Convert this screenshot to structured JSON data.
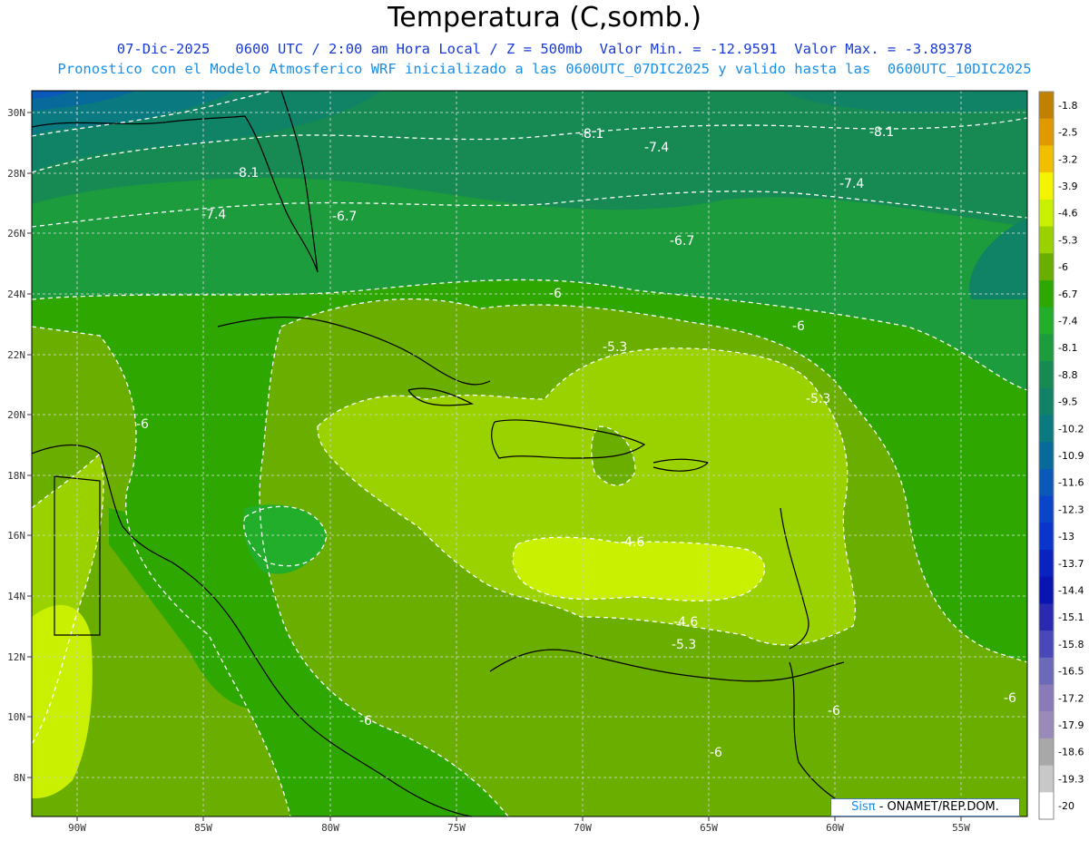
{
  "header": {
    "title": "Temperatura (C,somb.)",
    "line1": "07-Dic-2025   0600 UTC / 2:00 am Hora Local / Z = 500mb  Valor Min. = -12.9591  Valor Max. = -3.89378",
    "line2": "Pronostico con el Modelo Atmosferico WRF inicializado a las 0600UTC_07DIC2025 y valido hasta las  0600UTC_10DIC2025"
  },
  "map": {
    "lat_labels": [
      "30N",
      "28N",
      "26N",
      "24N",
      "22N",
      "20N",
      "18N",
      "16N",
      "14N",
      "12N",
      "10N",
      "8N"
    ],
    "lon_labels": [
      "90W",
      "85W",
      "80W",
      "75W",
      "70W",
      "65W",
      "60W",
      "55W"
    ],
    "contour_labels": [
      "-8.1",
      "-7.4",
      "-8.1",
      "-8.1",
      "-7.4",
      "-7.4",
      "-6.7",
      "-6.7",
      "-6",
      "-6",
      "-5.3",
      "-5.3",
      "-6",
      "-4.6",
      "-4.6",
      "-5.3",
      "-6",
      "-6",
      "-6",
      "-6"
    ]
  },
  "colorbar": {
    "labels": [
      "-1.8",
      "-2.5",
      "-3.2",
      "-3.9",
      "-4.6",
      "-5.3",
      "-6",
      "-6.7",
      "-7.4",
      "-8.1",
      "-8.8",
      "-9.5",
      "-10.2",
      "-10.9",
      "-11.6",
      "-12.3",
      "-13",
      "-13.7",
      "-14.4",
      "-15.1",
      "-15.8",
      "-16.5",
      "-17.2",
      "-17.9",
      "-18.6",
      "-19.3",
      "-20"
    ],
    "colors": [
      "#c08000",
      "#e09a00",
      "#f0c000",
      "#f4f400",
      "#c8f000",
      "#9ad200",
      "#6aae00",
      "#2ea800",
      "#22ad2a",
      "#1c9c3c",
      "#168a52",
      "#108266",
      "#0a7a80",
      "#086a9a",
      "#0a58b8",
      "#0a44c8",
      "#0a34cc",
      "#0a22c0",
      "#0a14b0",
      "#2a2ab0",
      "#4848b8",
      "#6a6ab8",
      "#8a7ab8",
      "#9a8aba",
      "#a8a8a8",
      "#c8c8c8",
      "#ffffff"
    ]
  },
  "credit": {
    "brand": "Sisπ",
    "text": " - ONAMET/REP.DOM."
  }
}
